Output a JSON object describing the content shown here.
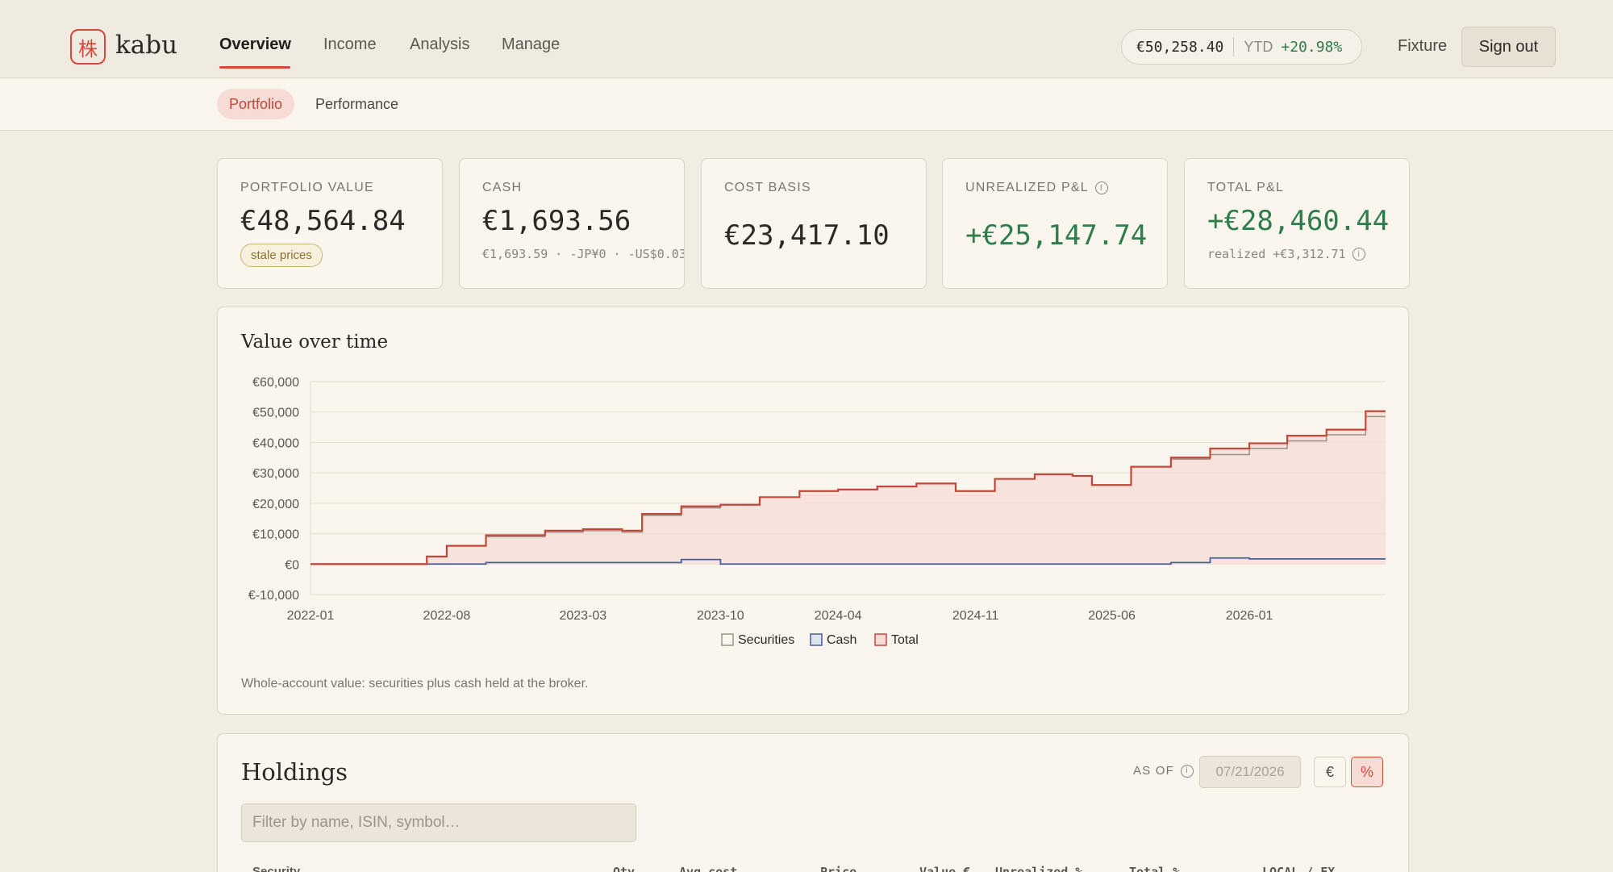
{
  "app": {
    "logo_glyph": "株",
    "name": "kabu"
  },
  "nav": {
    "items": [
      {
        "label": "Overview",
        "active": true
      },
      {
        "label": "Income",
        "active": false
      },
      {
        "label": "Analysis",
        "active": false
      },
      {
        "label": "Manage",
        "active": false
      }
    ]
  },
  "summary": {
    "value": "€50,258.40",
    "ytd_label": "YTD",
    "ytd_change": "+20.98%"
  },
  "header_actions": {
    "fixture_label": "Fixture",
    "signout_label": "Sign out"
  },
  "subnav": {
    "tabs": [
      {
        "label": "Portfolio",
        "active": true
      },
      {
        "label": "Performance",
        "active": false
      }
    ]
  },
  "cards": {
    "portfolio_value": {
      "label": "PORTFOLIO VALUE",
      "value": "€48,564.84",
      "badge": "stale prices"
    },
    "cash": {
      "label": "CASH",
      "value": "€1,693.56",
      "sub": "€1,693.59 · -JP¥0 · -US$0.03"
    },
    "cost_basis": {
      "label": "COST BASIS",
      "value": "€23,417.10"
    },
    "unrealized": {
      "label": "UNREALIZED P&L",
      "value": "+€25,147.74"
    },
    "total_pnl": {
      "label": "TOTAL P&L",
      "value": "+€28,460.44",
      "sub": "realized +€3,312.71"
    }
  },
  "chart_panel": {
    "title": "Value over time",
    "caption": "Whole-account value: securities plus cash held at the broker."
  },
  "chart_data": {
    "type": "area",
    "title": "Value over time",
    "ylim": [
      -10000,
      60000
    ],
    "y_ticks": [
      "€60,000",
      "€50,000",
      "€40,000",
      "€30,000",
      "€20,000",
      "€10,000",
      "€0",
      "€-10,000"
    ],
    "x_ticks": [
      "2022-01",
      "2022-08",
      "2023-03",
      "2023-10",
      "2024-04",
      "2024-11",
      "2025-06",
      "2026-01"
    ],
    "legend_position": "bottom-center",
    "grid": true,
    "x": [
      "2022-01",
      "2022-06",
      "2022-07",
      "2022-08",
      "2022-10",
      "2022-12",
      "2023-01",
      "2023-03",
      "2023-05",
      "2023-06",
      "2023-08",
      "2023-10",
      "2023-12",
      "2024-02",
      "2024-04",
      "2024-06",
      "2024-08",
      "2024-10",
      "2024-12",
      "2025-02",
      "2025-04",
      "2025-05",
      "2025-07",
      "2025-09",
      "2025-11",
      "2026-01",
      "2026-03",
      "2026-05",
      "2026-07"
    ],
    "series": [
      {
        "name": "Securities",
        "color": "#9b958b",
        "values": [
          0,
          0,
          2500,
          6000,
          9000,
          9000,
          10500,
          11000,
          10500,
          16000,
          18500,
          19500,
          22000,
          24000,
          24500,
          25500,
          26500,
          24000,
          28000,
          29500,
          29000,
          26000,
          32000,
          34500,
          36000,
          38000,
          40500,
          42500,
          48500
        ]
      },
      {
        "name": "Cash",
        "color": "#4a5f9a",
        "values": [
          0,
          0,
          0,
          0,
          500,
          500,
          500,
          500,
          500,
          500,
          1500,
          0,
          0,
          0,
          0,
          0,
          0,
          0,
          0,
          0,
          0,
          0,
          0,
          500,
          2000,
          1700,
          1700,
          1700,
          1693.56
        ]
      },
      {
        "name": "Total",
        "color": "#c6473a",
        "values": [
          0,
          0,
          2500,
          6000,
          9500,
          9500,
          11000,
          11500,
          11000,
          16500,
          19000,
          19500,
          22000,
          24000,
          24500,
          25500,
          26500,
          24000,
          28000,
          29500,
          29000,
          26000,
          32000,
          35000,
          38000,
          39700,
          42200,
          44200,
          50258.4
        ]
      }
    ]
  },
  "holdings": {
    "title": "Holdings",
    "as_of_label": "AS OF",
    "as_of_date": "07/21/2026",
    "toggle_eur": "€",
    "toggle_pct": "%",
    "filter_placeholder": "Filter by name, ISIN, symbol…",
    "columns": [
      "Security",
      "Qty",
      "Avg cost",
      "Price",
      "Value €",
      "Unrealized %",
      "Total %",
      "LOCAL / FX"
    ]
  },
  "colors": {
    "accent": "#d9473b",
    "positive": "#2e7d4a",
    "background": "#f1ede3",
    "card": "#faf6ee"
  }
}
